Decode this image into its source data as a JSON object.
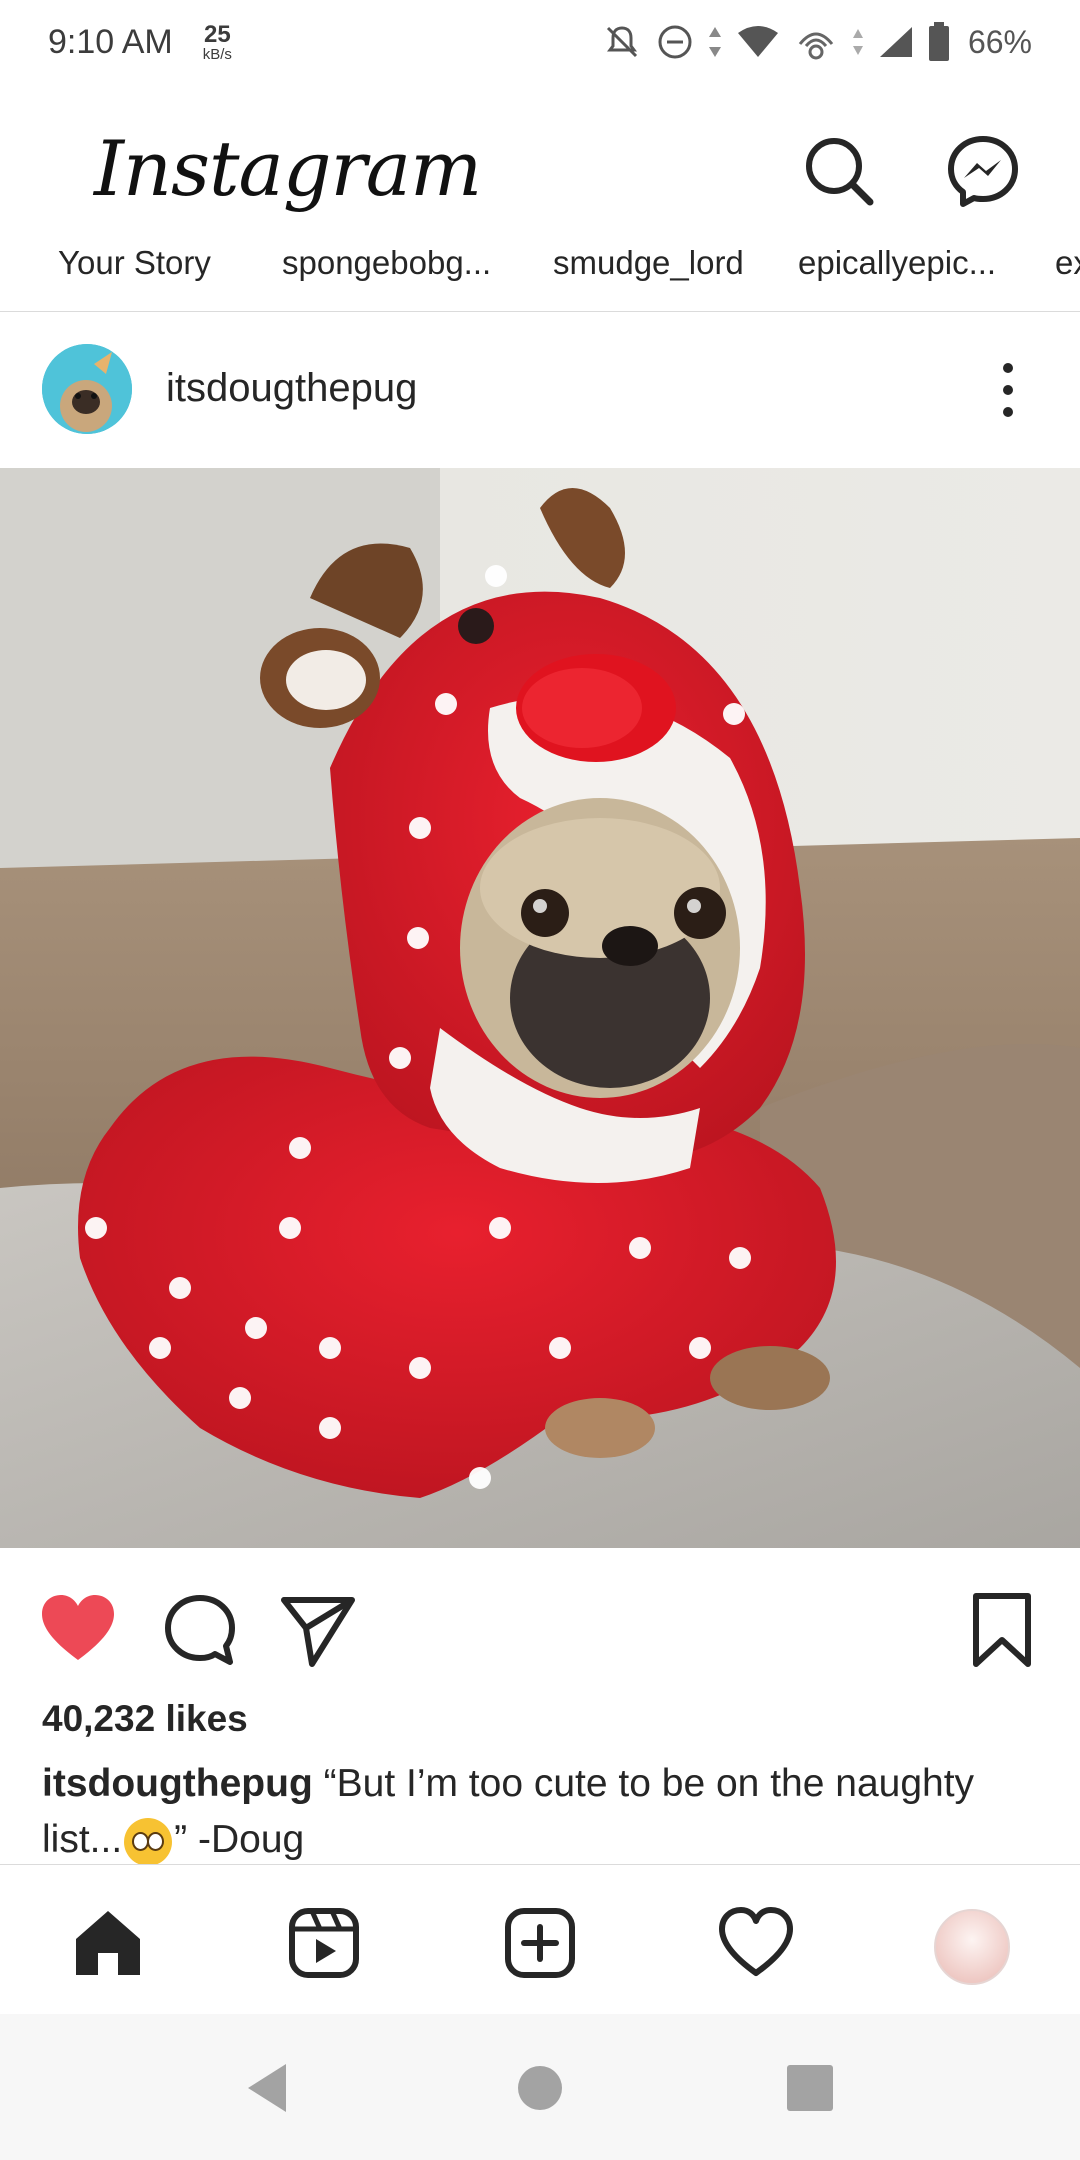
{
  "status_bar": {
    "time": "9:10 AM",
    "speed_value": "25",
    "speed_unit": "kB/s",
    "battery": "66%"
  },
  "header": {
    "logo": "Instagram",
    "icons": [
      "search-icon",
      "messenger-icon"
    ]
  },
  "stories": [
    {
      "label": "Your Story"
    },
    {
      "label": "spongebobg..."
    },
    {
      "label": "smudge_lord"
    },
    {
      "label": "epicallyepic..."
    },
    {
      "label": "ex"
    }
  ],
  "post": {
    "username": "itsdougthepug",
    "likes": "40,232 likes",
    "caption_user": "itsdougthepug",
    "caption_text_1": "“But I’m too cute to be on the naughty list...",
    "caption_text_2": "” -Doug",
    "liked": true
  },
  "bottom_nav": [
    "home-icon",
    "reels-icon",
    "new-post-icon",
    "activity-icon",
    "profile-avatar"
  ],
  "colors": {
    "like_red": "#ed4956",
    "text": "#262626",
    "divider": "#dbdbdb"
  }
}
